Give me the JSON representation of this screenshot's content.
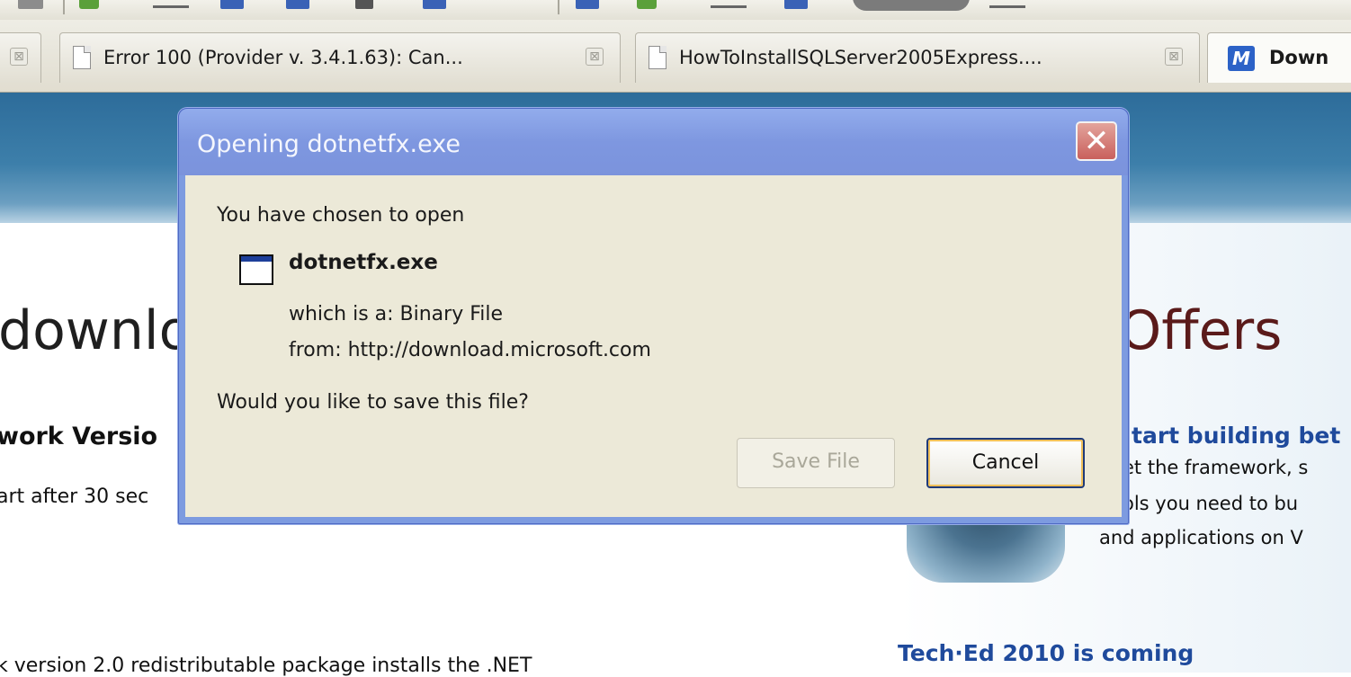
{
  "tabs": [
    {
      "label": "Error 100 (Provider v. 3.4.1.63): Can...",
      "close": "⊠"
    },
    {
      "label": "HowToInstallSQLServer2005Express....",
      "close": "⊠"
    },
    {
      "label": "Down",
      "icon_letter": "M"
    }
  ],
  "first_tab_close": "⊠",
  "page": {
    "heading_left": "downlo",
    "heading_right": "Offers",
    "version_text": "work Versio",
    "restart_text": "art after 30 sec",
    "redist_text": "k version 2.0 redistributable package installs the .NET",
    "start_link": "tart building bet",
    "right_line1": "et the framework, s",
    "right_line2": "ols you need to bu",
    "right_line3": "and applications on V",
    "teched_link": "Tech·Ed 2010 is coming"
  },
  "dialog": {
    "title": "Opening dotnetfx.exe",
    "close_glyph": "✕",
    "chosen_text": "You have chosen to open",
    "file_name": "dotnetfx.exe",
    "which_is": "which is a:  Binary File",
    "from": "from:  http://download.microsoft.com",
    "question": "Would you like to save this file?",
    "save_label": "Save File",
    "cancel_label": "Cancel"
  },
  "colors": {
    "titlebar": "#7e97e0",
    "dialog_face": "#ece9d8",
    "close_button": "#c9605c",
    "banner": "#3d7faa",
    "link": "#1f4a9c"
  }
}
